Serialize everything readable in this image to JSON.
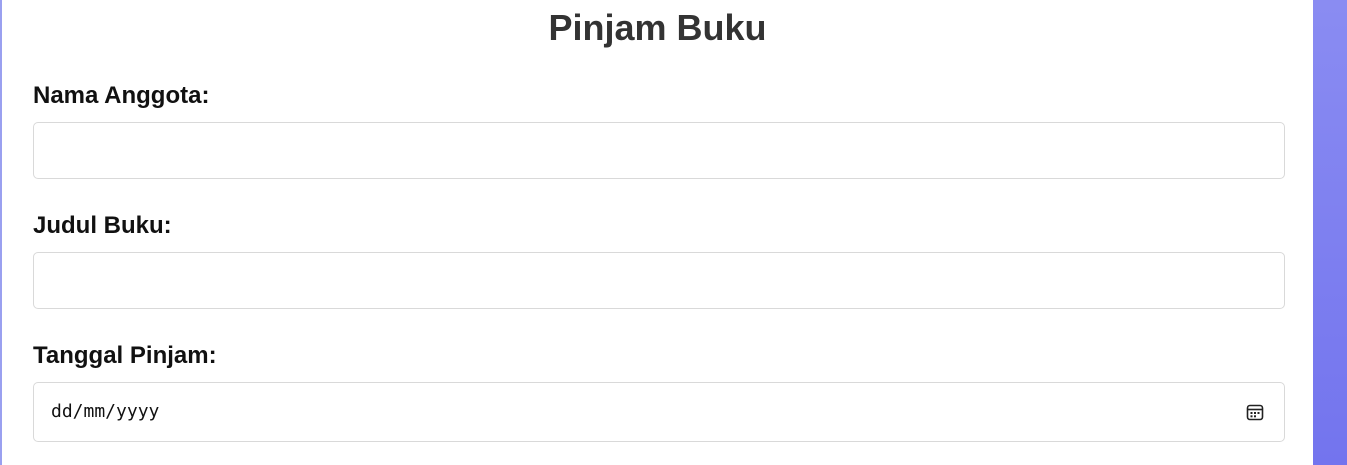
{
  "form": {
    "title": "Pinjam Buku",
    "member_label": "Nama Anggota:",
    "member_value": "",
    "book_label": "Judul Buku:",
    "book_value": "",
    "date_label": "Tanggal Pinjam:",
    "date_placeholder": "dd/mm/yyyy"
  },
  "icons": {
    "date_picker": "calendar-icon"
  },
  "colors": {
    "background_accent": "#7b7df0",
    "title": "#333333",
    "field_border": "#d9d9d9"
  }
}
